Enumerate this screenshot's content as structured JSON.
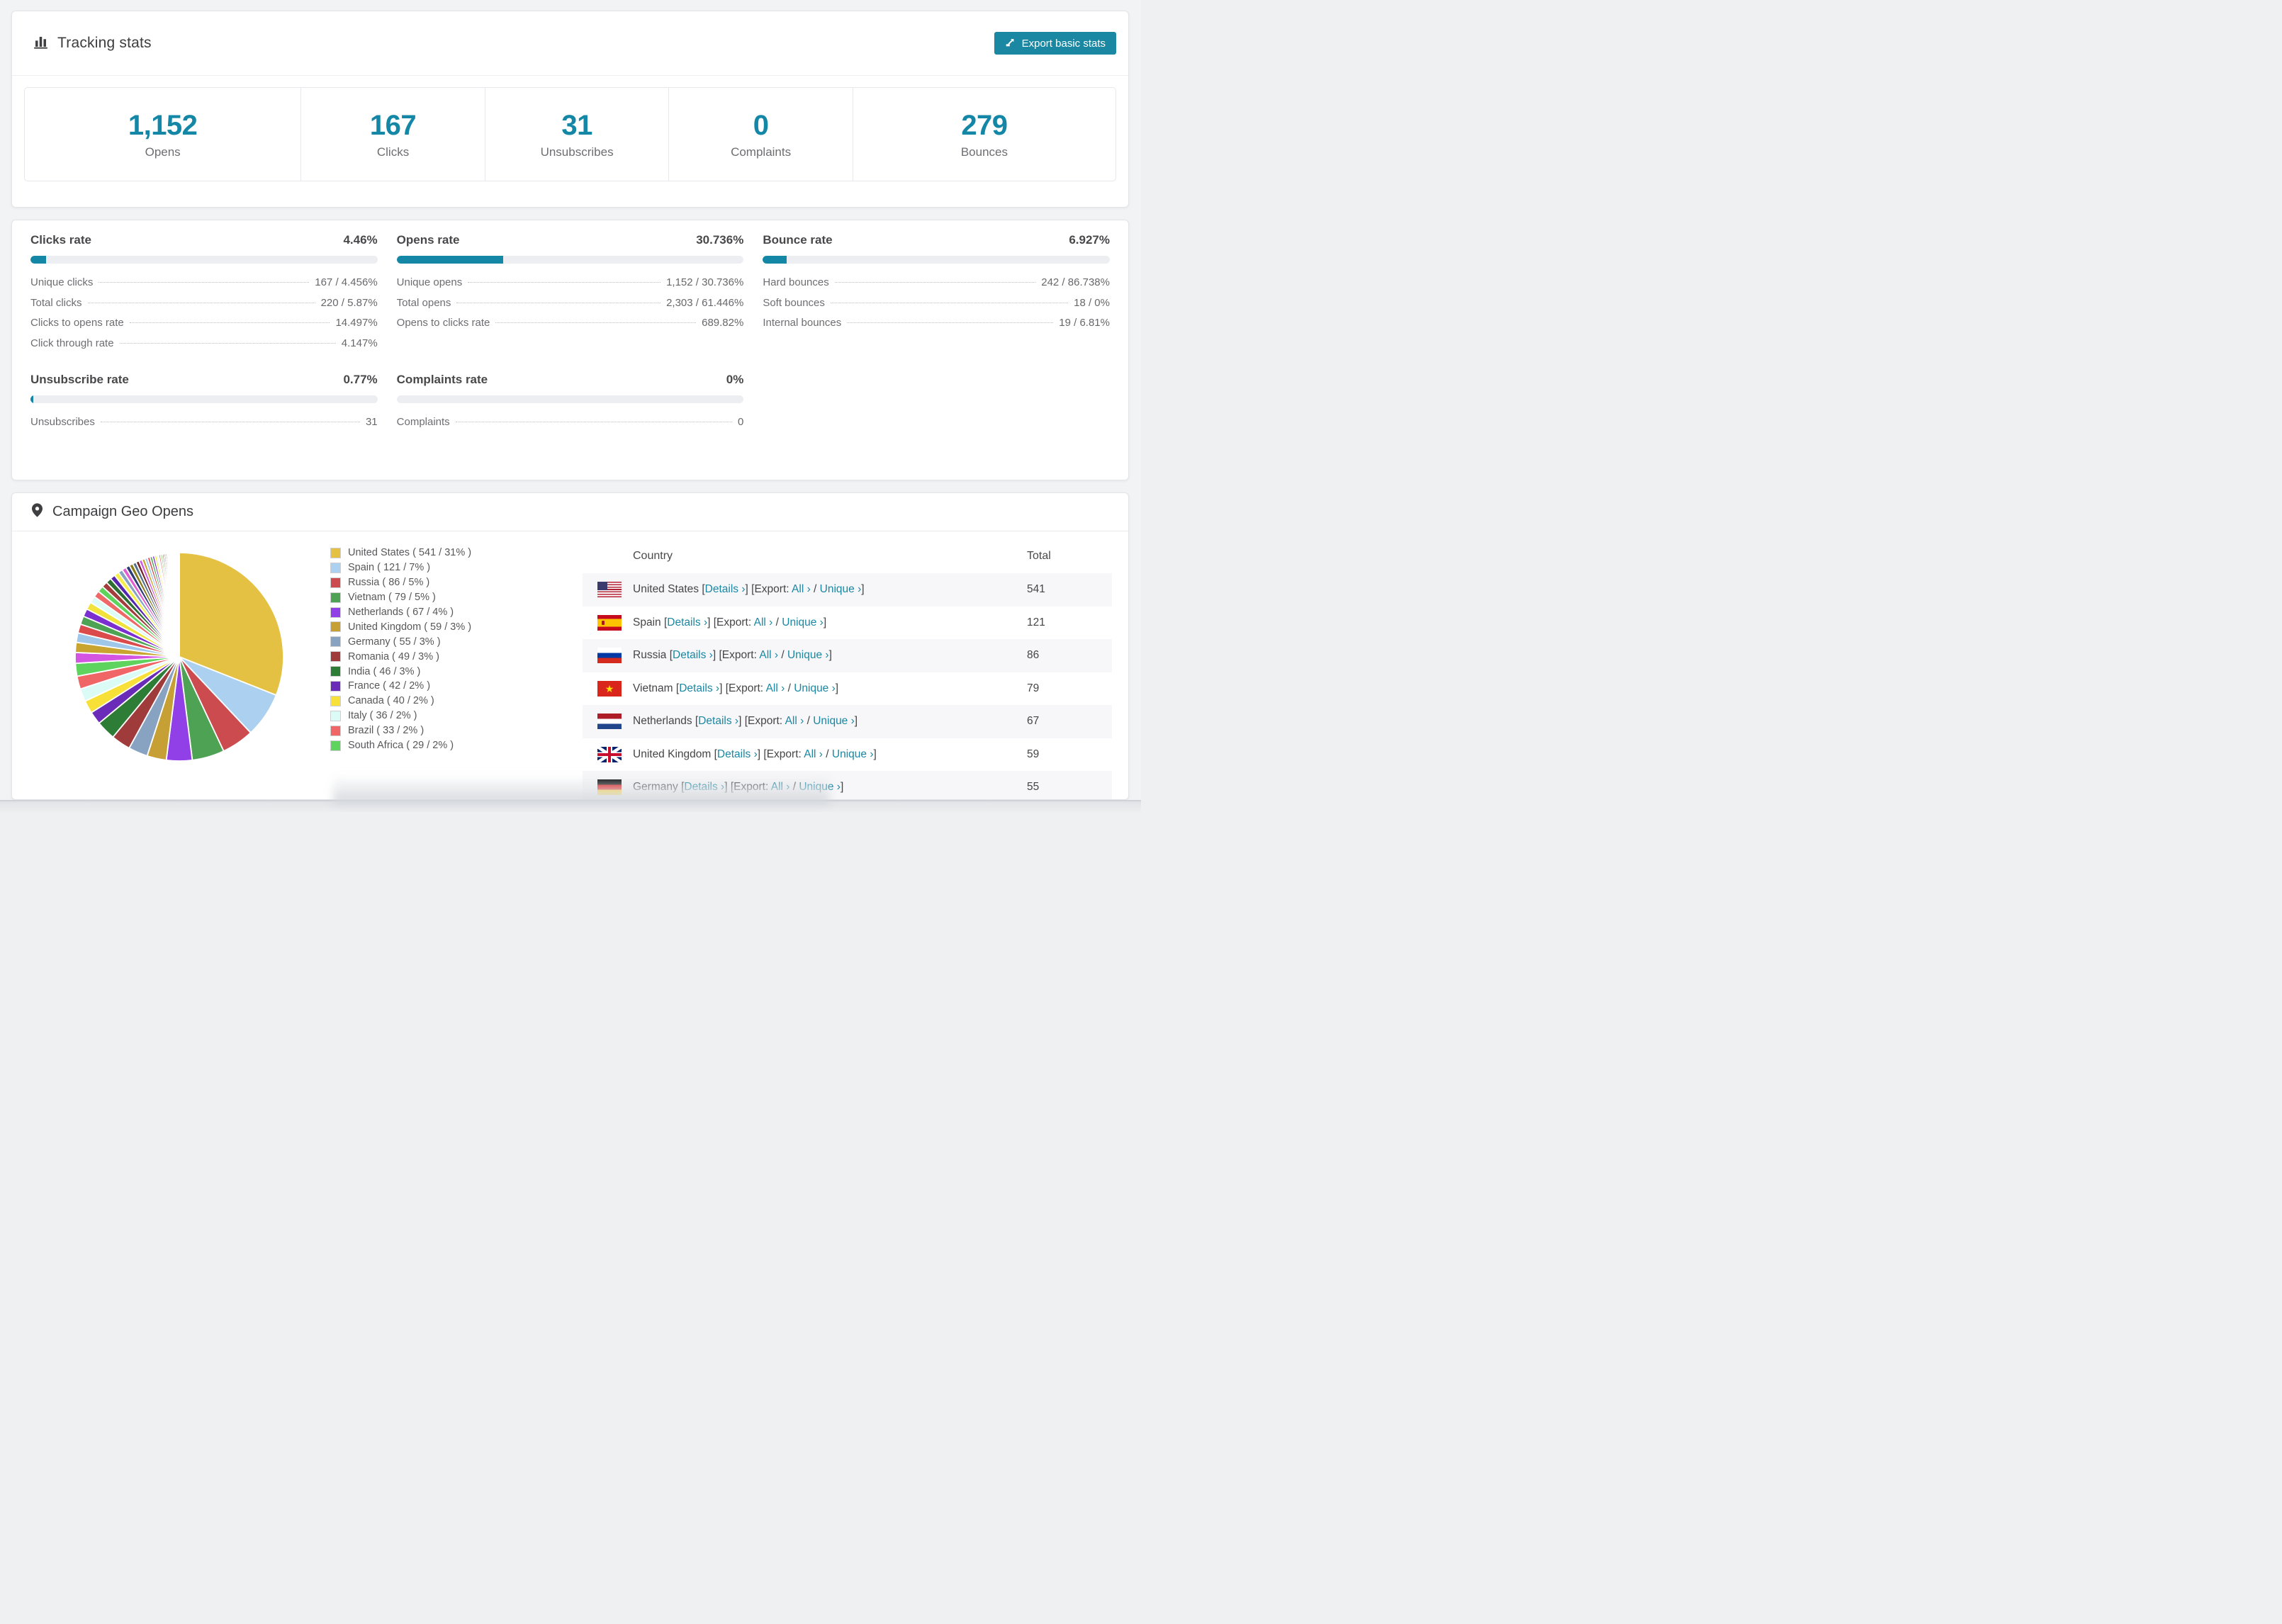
{
  "accent_color": "#1a87a3",
  "header": {
    "title": "Tracking stats",
    "export_label": "Export basic stats"
  },
  "summary": [
    {
      "value": "1,152",
      "label": "Opens"
    },
    {
      "value": "167",
      "label": "Clicks"
    },
    {
      "value": "31",
      "label": "Unsubscribes"
    },
    {
      "value": "0",
      "label": "Complaints"
    },
    {
      "value": "279",
      "label": "Bounces"
    }
  ],
  "rates": [
    {
      "title": "Clicks rate",
      "value": "4.46%",
      "percent": 4.46,
      "rows": [
        {
          "label": "Unique clicks",
          "value": "167 / 4.456%"
        },
        {
          "label": "Total clicks",
          "value": "220 / 5.87%"
        },
        {
          "label": "Clicks to opens rate",
          "value": "14.497%"
        },
        {
          "label": "Click through rate",
          "value": "4.147%"
        }
      ]
    },
    {
      "title": "Opens rate",
      "value": "30.736%",
      "percent": 30.736,
      "rows": [
        {
          "label": "Unique opens",
          "value": "1,152 / 30.736%"
        },
        {
          "label": "Total opens",
          "value": "2,303 / 61.446%"
        },
        {
          "label": "Opens to clicks rate",
          "value": "689.82%"
        }
      ]
    },
    {
      "title": "Bounce rate",
      "value": "6.927%",
      "percent": 6.927,
      "rows": [
        {
          "label": "Hard bounces",
          "value": "242 / 86.738%"
        },
        {
          "label": "Soft bounces",
          "value": "18 / 0%"
        },
        {
          "label": "Internal bounces",
          "value": "19 / 6.81%"
        }
      ]
    },
    {
      "title": "Unsubscribe rate",
      "value": "0.77%",
      "percent": 0.77,
      "rows": [
        {
          "label": "Unsubscribes",
          "value": "31"
        }
      ]
    },
    {
      "title": "Complaints rate",
      "value": "0%",
      "percent": 0,
      "rows": [
        {
          "label": "Complaints",
          "value": "0"
        }
      ]
    }
  ],
  "geo": {
    "title": "Campaign Geo Opens",
    "chart_data": {
      "type": "pie",
      "title": "Campaign Geo Opens",
      "unit": "opens",
      "start_angle_deg": 0,
      "direction": "clockwise",
      "slices": [
        {
          "label": "United States",
          "value": 541,
          "percent": 31,
          "color": "#e5c143"
        },
        {
          "label": "Spain",
          "value": 121,
          "percent": 7,
          "color": "#abd0f0"
        },
        {
          "label": "Russia",
          "value": 86,
          "percent": 5,
          "color": "#cb4b4e"
        },
        {
          "label": "Vietnam",
          "value": 79,
          "percent": 5,
          "color": "#4da253"
        },
        {
          "label": "Netherlands",
          "value": 67,
          "percent": 4,
          "color": "#9140e8"
        },
        {
          "label": "United Kingdom",
          "value": 59,
          "percent": 3,
          "color": "#c7a035"
        },
        {
          "label": "Germany",
          "value": 55,
          "percent": 3,
          "color": "#87a3c1"
        },
        {
          "label": "Romania",
          "value": 49,
          "percent": 3,
          "color": "#a03b3b"
        },
        {
          "label": "India",
          "value": 46,
          "percent": 3,
          "color": "#2e7d36"
        },
        {
          "label": "France",
          "value": 42,
          "percent": 2,
          "color": "#6a2bb8"
        },
        {
          "label": "Canada",
          "value": 40,
          "percent": 2,
          "color": "#f7e139"
        },
        {
          "label": "Italy",
          "value": 36,
          "percent": 2,
          "color": "#dbfcf6"
        },
        {
          "label": "Brazil",
          "value": 33,
          "percent": 2,
          "color": "#f06666"
        },
        {
          "label": "South Africa",
          "value": 29,
          "percent": 2,
          "color": "#5ed45e"
        }
      ],
      "others_unlabeled": {
        "note": "many small unlabeled slices fanning out",
        "approx_count": 45,
        "total_percent": 26,
        "decay": 0.94,
        "palette": [
          "#d355e2",
          "#c9a42f",
          "#9fc7ea",
          "#dc4b4b",
          "#4da253",
          "#7b2fd0",
          "#f2e33c",
          "#dcfcf5",
          "#ef6868",
          "#5cd35c",
          "#a33d3d",
          "#2d6e33",
          "#5527b0",
          "#f7ef49",
          "#87a3c1",
          "#e25fd2",
          "#2c3a78",
          "#8a7c1a",
          "#55708a",
          "#73252a"
        ]
      },
      "legend_position": "right",
      "legend_format": "Name ( value / percent% )"
    },
    "table": {
      "columns": [
        "Country",
        "Total"
      ],
      "link_labels": {
        "details": "Details ›",
        "export_prefix": "[Export:",
        "all": "All ›",
        "unique": "Unique ›"
      },
      "rows": [
        {
          "country": "United States",
          "flag": "us",
          "total": "541"
        },
        {
          "country": "Spain",
          "flag": "es",
          "total": "121"
        },
        {
          "country": "Russia",
          "flag": "ru",
          "total": "86"
        },
        {
          "country": "Vietnam",
          "flag": "vn",
          "total": "79"
        },
        {
          "country": "Netherlands",
          "flag": "nl",
          "total": "67"
        },
        {
          "country": "United Kingdom",
          "flag": "gb",
          "total": "59"
        },
        {
          "country": "Germany",
          "flag": "de",
          "total": "55"
        }
      ]
    }
  }
}
